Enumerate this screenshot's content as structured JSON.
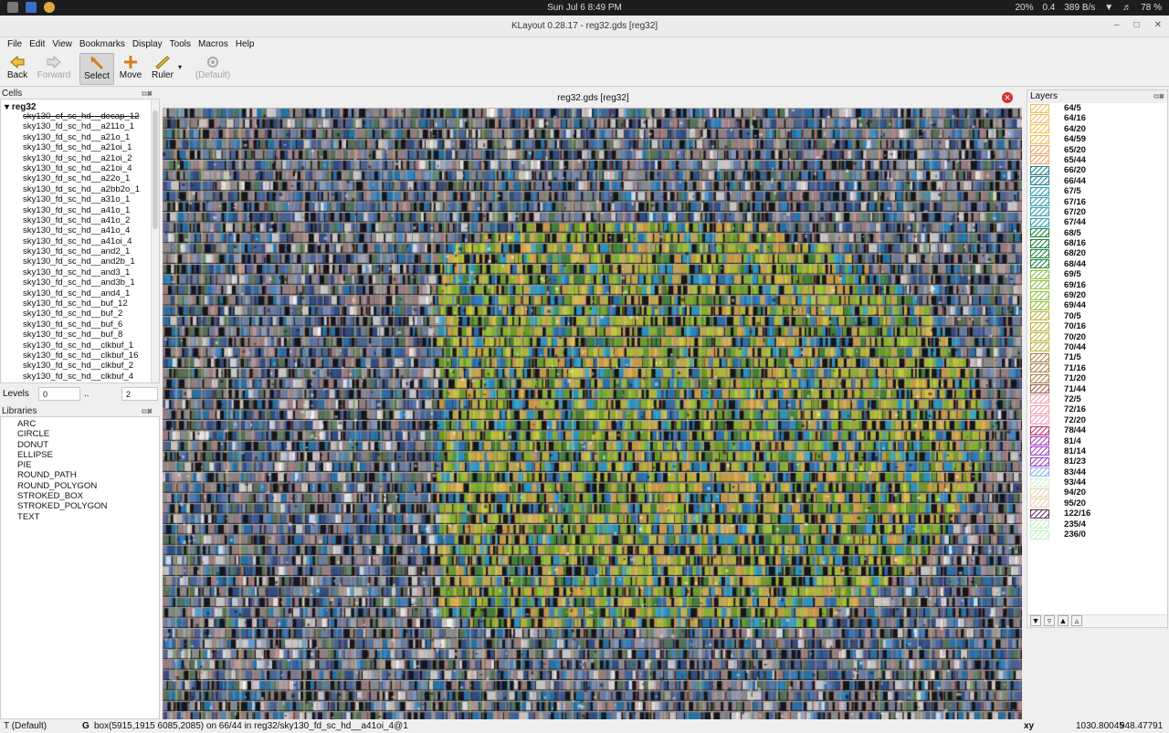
{
  "topbar": {
    "clock": "Sun Jul 6   8:49 PM",
    "cpu": "20%",
    "load": "0.4",
    "net": "389 B/s",
    "battery": "78 %"
  },
  "window": {
    "title": "KLayout 0.28.17 - reg32.gds [reg32]"
  },
  "menu": [
    "File",
    "Edit",
    "View",
    "Bookmarks",
    "Display",
    "Tools",
    "Macros",
    "Help"
  ],
  "toolbar": {
    "back": "Back",
    "forward": "Forward",
    "select": "Select",
    "move": "Move",
    "ruler": "Ruler",
    "default": "(Default)"
  },
  "cells": {
    "title": "Cells",
    "root": "reg32",
    "items": [
      "sky130_ef_sc_hd__decap_12",
      "sky130_fd_sc_hd__a211o_1",
      "sky130_fd_sc_hd__a21o_1",
      "sky130_fd_sc_hd__a21oi_1",
      "sky130_fd_sc_hd__a21oi_2",
      "sky130_fd_sc_hd__a21oi_4",
      "sky130_fd_sc_hd__a22o_1",
      "sky130_fd_sc_hd__a2bb2o_1",
      "sky130_fd_sc_hd__a31o_1",
      "sky130_fd_sc_hd__a41o_1",
      "sky130_fd_sc_hd__a41o_2",
      "sky130_fd_sc_hd__a41o_4",
      "sky130_fd_sc_hd__a41oi_4",
      "sky130_fd_sc_hd__and2_1",
      "sky130_fd_sc_hd__and2b_1",
      "sky130_fd_sc_hd__and3_1",
      "sky130_fd_sc_hd__and3b_1",
      "sky130_fd_sc_hd__and4_1",
      "sky130_fd_sc_hd__buf_12",
      "sky130_fd_sc_hd__buf_2",
      "sky130_fd_sc_hd__buf_6",
      "sky130_fd_sc_hd__buf_8",
      "sky130_fd_sc_hd__clkbuf_1",
      "sky130_fd_sc_hd__clkbuf_16",
      "sky130_fd_sc_hd__clkbuf_2",
      "sky130_fd_sc_hd__clkbuf_4"
    ]
  },
  "levels": {
    "label": "Levels",
    "from": "0",
    "sep": "..",
    "to": "2"
  },
  "libraries": {
    "title": "Libraries",
    "items": [
      "ARC",
      "CIRCLE",
      "DONUT",
      "ELLIPSE",
      "PIE",
      "ROUND_PATH",
      "ROUND_POLYGON",
      "STROKED_BOX",
      "STROKED_POLYGON",
      "TEXT"
    ]
  },
  "layout": {
    "title": "reg32.gds [reg32]"
  },
  "layers": {
    "title": "Layers",
    "items": [
      {
        "name": "64/5",
        "color": "#f0c060"
      },
      {
        "name": "64/16",
        "color": "#f0c060"
      },
      {
        "name": "64/20",
        "color": "#f0c060"
      },
      {
        "name": "64/59",
        "color": "#f0c060"
      },
      {
        "name": "65/20",
        "color": "#f0a070"
      },
      {
        "name": "65/44",
        "color": "#f0a070"
      },
      {
        "name": "66/20",
        "color": "#208090"
      },
      {
        "name": "66/44",
        "color": "#208090"
      },
      {
        "name": "67/5",
        "color": "#30a0b0"
      },
      {
        "name": "67/16",
        "color": "#30a0b0"
      },
      {
        "name": "67/20",
        "color": "#30a0b0"
      },
      {
        "name": "67/44",
        "color": "#30a0b0"
      },
      {
        "name": "68/5",
        "color": "#208040"
      },
      {
        "name": "68/16",
        "color": "#208040"
      },
      {
        "name": "68/20",
        "color": "#208040"
      },
      {
        "name": "68/44",
        "color": "#208040"
      },
      {
        "name": "69/5",
        "color": "#90c040"
      },
      {
        "name": "69/16",
        "color": "#90c040"
      },
      {
        "name": "69/20",
        "color": "#90c040"
      },
      {
        "name": "69/44",
        "color": "#90c040"
      },
      {
        "name": "70/5",
        "color": "#c0b040"
      },
      {
        "name": "70/16",
        "color": "#c0b040"
      },
      {
        "name": "70/20",
        "color": "#c0b040"
      },
      {
        "name": "70/44",
        "color": "#c0b040"
      },
      {
        "name": "71/5",
        "color": "#b08050"
      },
      {
        "name": "71/16",
        "color": "#b08050"
      },
      {
        "name": "71/20",
        "color": "#b08050"
      },
      {
        "name": "71/44",
        "color": "#a06040"
      },
      {
        "name": "72/5",
        "color": "#f0a0b0"
      },
      {
        "name": "72/16",
        "color": "#f0a0b0"
      },
      {
        "name": "72/20",
        "color": "#f0a0b0"
      },
      {
        "name": "78/44",
        "color": "#c03060"
      },
      {
        "name": "81/4",
        "color": "#a040c0"
      },
      {
        "name": "81/14",
        "color": "#a040c0"
      },
      {
        "name": "81/23",
        "color": "#a040c0"
      },
      {
        "name": "83/44",
        "color": "#90b0f0"
      },
      {
        "name": "93/44",
        "color": "#d0f0d0"
      },
      {
        "name": "94/20",
        "color": "#f0d0b0"
      },
      {
        "name": "95/20",
        "color": "#f0d0b0"
      },
      {
        "name": "122/16",
        "color": "#603060"
      },
      {
        "name": "235/4",
        "color": "#c0f0c0"
      },
      {
        "name": "236/0",
        "color": "#c0f0c0"
      }
    ]
  },
  "status": {
    "mode": "T (Default)",
    "g": "G",
    "info": "box(5915,1915 6085,2085) on 66/44 in reg32/sky130_fd_sc_hd__a41oi_4@1",
    "xy_label": "xy",
    "x": "1030.80045",
    "y": "948.47791"
  }
}
